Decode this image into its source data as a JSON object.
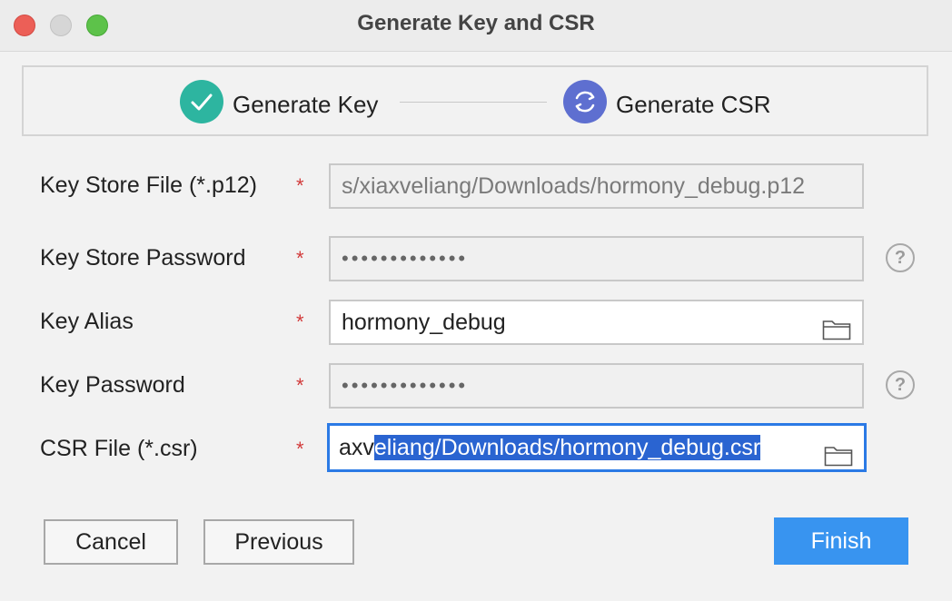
{
  "window": {
    "title": "Generate Key and CSR"
  },
  "steps": [
    {
      "label": "Generate Key",
      "status": "done",
      "icon": "checkmark-icon",
      "color": "#2db5a0"
    },
    {
      "label": "Generate CSR",
      "status": "in-progress",
      "icon": "refresh-icon",
      "color": "#5e6fd0"
    }
  ],
  "form": {
    "required_mark": "*",
    "key_store_file": {
      "label": "Key Store File (*.p12)",
      "value": "s/xiaxveliang/Downloads/hormony_debug.p12",
      "enabled": false
    },
    "key_store_password": {
      "label": "Key Store Password",
      "value": "•••••••••••••",
      "enabled": false,
      "help": "?"
    },
    "key_alias": {
      "label": "Key Alias",
      "value": "hormony_debug",
      "enabled": true
    },
    "key_password": {
      "label": "Key Password",
      "value": "•••••••••••••",
      "enabled": false,
      "help": "?"
    },
    "csr_file": {
      "label": "CSR File (*.csr)",
      "value_unselected": "axv",
      "value_selected": "eliang/Downloads/hormony_debug.csr",
      "focused": true
    }
  },
  "buttons": {
    "cancel": "Cancel",
    "previous": "Previous",
    "finish": "Finish"
  },
  "colors": {
    "accent": "#2b7ae5",
    "primary_button": "#3894f0",
    "required": "#d23a3a"
  }
}
